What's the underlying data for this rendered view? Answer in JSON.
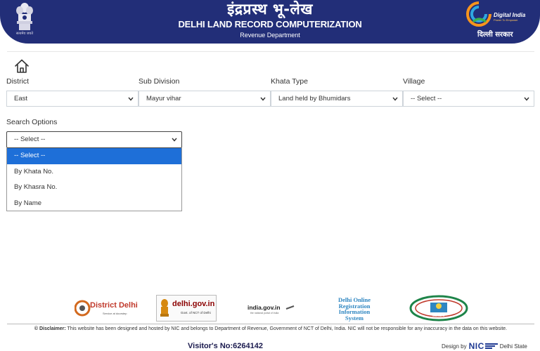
{
  "header": {
    "hindi_title": "इंद्रप्रस्थ भू-लेख",
    "title": "DELHI LAND RECORD COMPUTERIZATION",
    "subtitle": "Revenue Department",
    "emblem_caption": "सत्यमेव जयते",
    "digital_india": "Digital India",
    "digital_india_tagline": "Power To Empower",
    "delhi_sarkar": "दिल्ली सरकार"
  },
  "filters": {
    "district": {
      "label": "District",
      "value": "East"
    },
    "sub_division": {
      "label": "Sub Division",
      "value": "Mayur vihar"
    },
    "khata_type": {
      "label": "Khata Type",
      "value": "Land held by Bhumidars"
    },
    "village": {
      "label": "Village",
      "value": "-- Select --"
    }
  },
  "search_options": {
    "label": "Search Options",
    "value": "-- Select --",
    "options": [
      "-- Select --",
      "By Khata No.",
      "By Khasra No.",
      "By Name"
    ],
    "selected_index": 0
  },
  "footer": {
    "logos": {
      "district_delhi": "District Delhi",
      "district_delhi_sub": "Service at doorstep",
      "delhi_gov": "delhi.gov.in",
      "delhi_gov_sub": "Govt. of NCT of Delhi",
      "india_gov": "india.gov.in",
      "india_gov_sub": "the national portal of India",
      "doris_1": "Delhi Online",
      "doris_2": "Registration",
      "doris_3": "Information",
      "doris_4": "System",
      "cersai": "CERSAI"
    },
    "disclaimer_label": "© Disclaimer:",
    "disclaimer": "This website has been designed and hosted by NIC and belongs to Department of Revenue, Government of NCT of Delhi, India. NIC will not be responsible for any inaccuracy in the data on this website.",
    "visitor": "Visitor's No:6264142",
    "design_by": "Design by",
    "nic": "NIC",
    "delhi_state": "Delhi State"
  },
  "colors": {
    "header_bg": "#222e78",
    "selected_option": "#1e6fd8"
  }
}
